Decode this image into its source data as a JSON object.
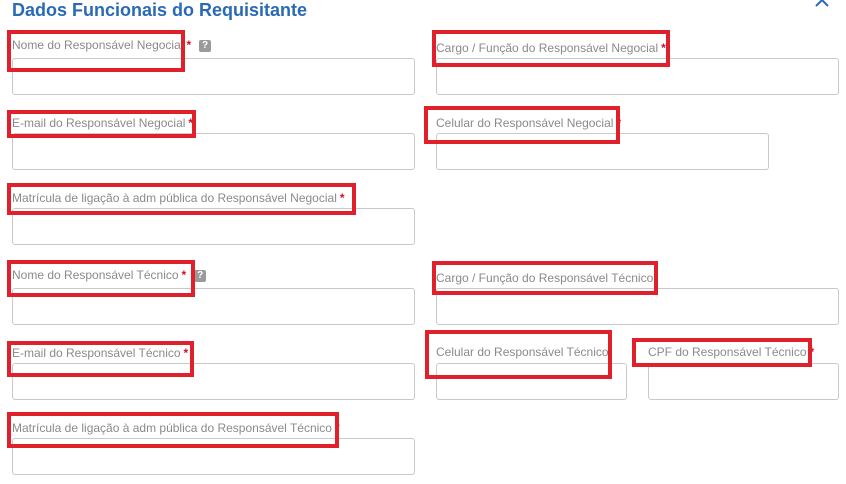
{
  "section": {
    "title": "Dados Funcionais do Requisitante",
    "collapse_icon": "chevron-up-icon"
  },
  "fields": {
    "nome_negocial": {
      "label": "Nome do Responsável Negocial",
      "required": "*",
      "help": "?",
      "value": ""
    },
    "cargo_negocial": {
      "label": "Cargo / Função do Responsável Negocial",
      "required": "*",
      "value": ""
    },
    "email_negocial": {
      "label": "E-mail do Responsável Negocial",
      "required": "*",
      "value": ""
    },
    "celular_negocial": {
      "label": "Celular do Responsável Negocial",
      "required": "*",
      "value": ""
    },
    "matricula_negocial": {
      "label": "Matrícula de ligação à adm pública do Responsável Negocial",
      "required": "*",
      "value": ""
    },
    "nome_tecnico": {
      "label": "Nome do Responsável Técnico",
      "required": "*",
      "help": "?",
      "value": ""
    },
    "cargo_tecnico": {
      "label": "Cargo / Função do Responsável Técnico",
      "value": ""
    },
    "email_tecnico": {
      "label": "E-mail do Responsável Técnico",
      "required": "*",
      "value": ""
    },
    "celular_tecnico": {
      "label": "Celular do Responsável Técnico",
      "value": ""
    },
    "cpf_tecnico": {
      "label": "CPF do Responsável Técnico",
      "required": "*",
      "value": ""
    },
    "matricula_tecnico": {
      "label": "Matrícula de ligação à adm pública do Responsável Técnico",
      "required": "*",
      "value": ""
    }
  },
  "colors": {
    "title": "#2a6ab5",
    "required": "#d0102b",
    "highlight": "#e0212b",
    "label": "#8a8a8a",
    "border": "#c9c9c9"
  }
}
